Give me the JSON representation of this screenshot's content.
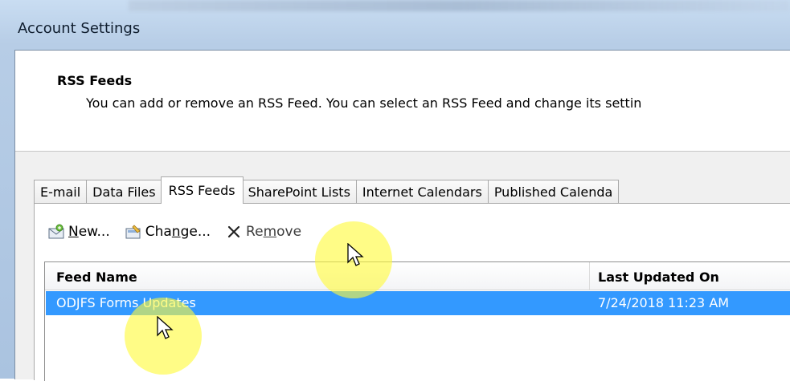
{
  "window": {
    "title": "Account Settings"
  },
  "header": {
    "title": "RSS Feeds",
    "description": "You can add or remove an RSS Feed. You can select an RSS Feed and change its settin"
  },
  "tabs": [
    {
      "label": "E-mail",
      "active": false
    },
    {
      "label": "Data Files",
      "active": false
    },
    {
      "label": "RSS Feeds",
      "active": true
    },
    {
      "label": "SharePoint Lists",
      "active": false
    },
    {
      "label": "Internet Calendars",
      "active": false
    },
    {
      "label": "Published Calenda",
      "active": false
    }
  ],
  "toolbar": {
    "new": {
      "pre": "",
      "ul": "N",
      "post": "ew...",
      "icon": "new-feed-icon"
    },
    "change": {
      "pre": "Cha",
      "ul": "n",
      "post": "ge...",
      "icon": "change-feed-icon"
    },
    "remove": {
      "pre": "Re",
      "ul": "m",
      "post": "ove",
      "icon": "remove-x-icon"
    }
  },
  "feed_list": {
    "columns": [
      "Feed Name",
      "Last Updated On"
    ],
    "rows": [
      {
        "name": "ODJFS Forms Updates",
        "last_updated": "7/24/2018 11:23 AM",
        "selected": true
      }
    ]
  },
  "colors": {
    "selection": "#3399ff",
    "cursor_highlight": "#fff83c",
    "window_frame": "#b7cde6"
  }
}
